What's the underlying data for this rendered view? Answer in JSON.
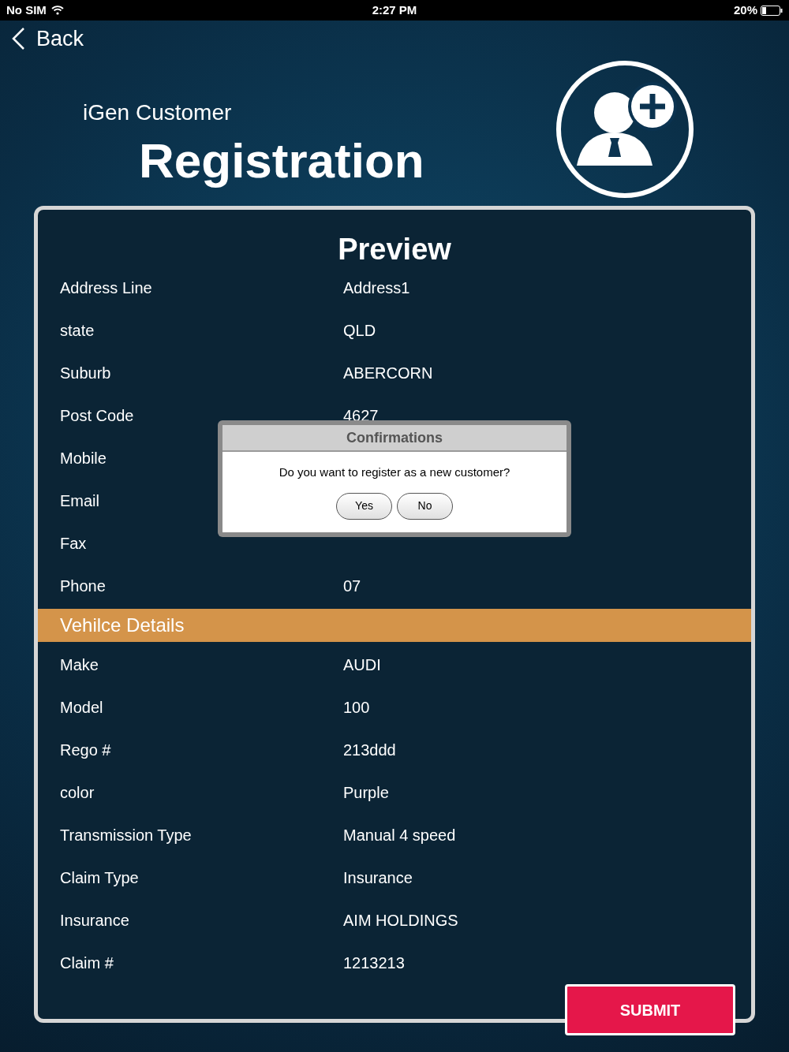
{
  "status_bar": {
    "carrier": "No SIM",
    "time": "2:27 PM",
    "battery": "20%"
  },
  "back": "Back",
  "header": {
    "subtitle": "iGen Customer",
    "title": "Registration"
  },
  "preview": {
    "title": "Preview",
    "rows": [
      {
        "kind": "field",
        "label": "Address Line",
        "value": "Address1"
      },
      {
        "kind": "field",
        "label": "state",
        "value": "QLD"
      },
      {
        "kind": "field",
        "label": "Suburb",
        "value": "ABERCORN"
      },
      {
        "kind": "field",
        "label": "Post Code",
        "value": "4627"
      },
      {
        "kind": "field",
        "label": "Mobile"
      },
      {
        "kind": "field",
        "label": "Email"
      },
      {
        "kind": "field",
        "label": "Fax"
      },
      {
        "kind": "field",
        "label": "Phone",
        "value": "07"
      },
      {
        "kind": "section",
        "label": "Vehilce Details"
      },
      {
        "kind": "field",
        "label": "Make",
        "value": "AUDI"
      },
      {
        "kind": "field",
        "label": "Model",
        "value": "100"
      },
      {
        "kind": "field",
        "label": "Rego #",
        "value": "213ddd"
      },
      {
        "kind": "field",
        "label": "color",
        "value": "Purple"
      },
      {
        "kind": "field",
        "label": "Transmission Type",
        "value": "Manual 4 speed"
      },
      {
        "kind": "field",
        "label": "Claim Type",
        "value": "Insurance"
      },
      {
        "kind": "field",
        "label": "Insurance",
        "value": "AIM HOLDINGS"
      },
      {
        "kind": "field",
        "label": "Claim #",
        "value": "1213213"
      }
    ],
    "submit": "SUBMIT"
  },
  "dialog": {
    "title": "Confirmations",
    "message": "Do you want to register as a new customer?",
    "buttons": [
      "Yes",
      "No"
    ]
  }
}
